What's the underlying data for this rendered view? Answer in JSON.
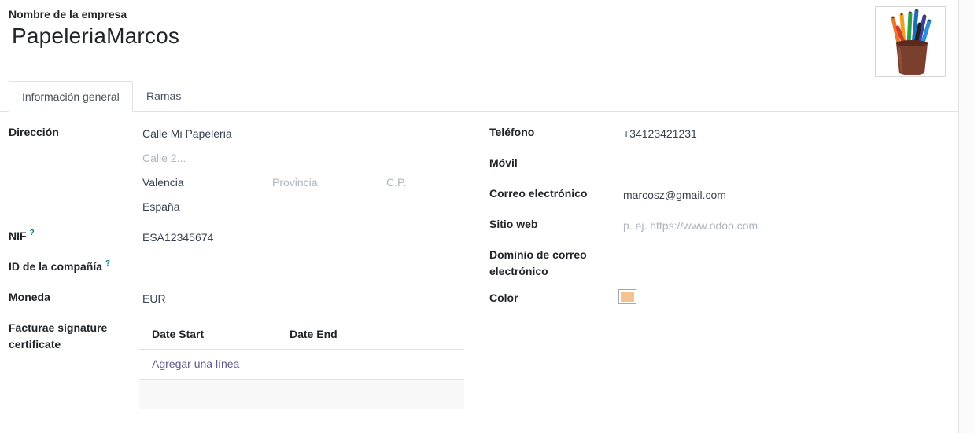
{
  "header": {
    "company_label": "Nombre de la empresa",
    "company_name": "PapeleriaMarcos"
  },
  "tabs": [
    {
      "label": "Información general",
      "active": true
    },
    {
      "label": "Ramas",
      "active": false
    }
  ],
  "left": {
    "address_label": "Dirección",
    "street": "Calle Mi Papeleria",
    "street2_placeholder": "Calle 2...",
    "city": "Valencia",
    "state_placeholder": "Provincia",
    "zip_placeholder": "C.P.",
    "country": "España",
    "vat_label": "NIF",
    "vat_help": "?",
    "vat_value": "ESA12345674",
    "company_id_label": "ID de la compañía",
    "company_id_help": "?",
    "currency_label": "Moneda",
    "currency_value": "EUR",
    "facturae_label_line1": "Facturae signature",
    "facturae_label_line2": "certificate",
    "table": {
      "columns": [
        "Date Start",
        "Date End"
      ],
      "add_line": "Agregar una línea"
    }
  },
  "right": {
    "phone_label": "Teléfono",
    "phone_value": "+34123421231",
    "mobile_label": "Móvil",
    "email_label": "Correo electrónico",
    "email_value": "marcosz@gmail.com",
    "website_label": "Sitio web",
    "website_placeholder": "p. ej. https://www.odoo.com",
    "email_domain_label_line1": "Dominio de correo",
    "email_domain_label_line2": "electrónico",
    "color_label": "Color",
    "color_value": "#f4c391"
  }
}
